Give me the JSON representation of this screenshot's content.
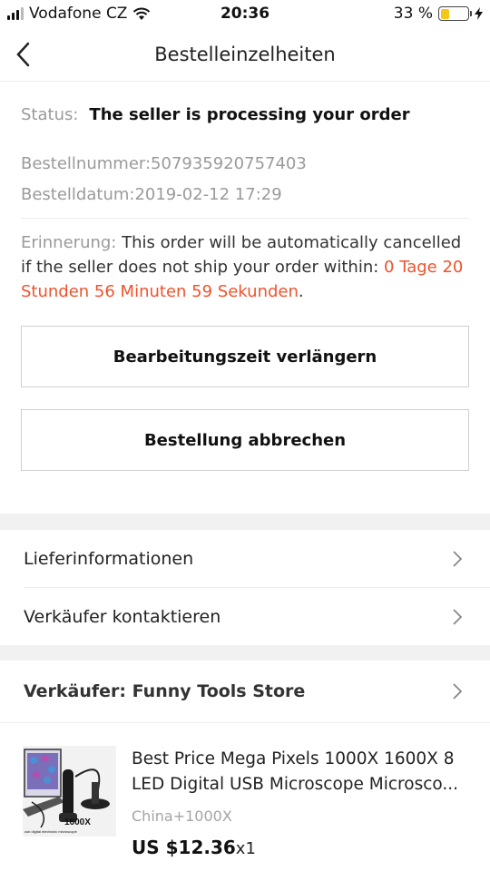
{
  "statusbar": {
    "carrier": "Vodafone CZ",
    "time": "20:36",
    "battery": "33 %",
    "battery_level": 0.33
  },
  "header": {
    "title": "Bestelleinzelheiten"
  },
  "order": {
    "status_label": "Status:",
    "status_value": "The seller is processing your order",
    "number": "Bestellnummer:507935920757403",
    "date": "Bestelldatum:2019-02-12 17:29",
    "reminder_label": "Erinnerung:",
    "reminder_text": " This order will be automatically cancelled if the seller does not ship your order within: ",
    "countdown": "0 Tage 20 Stunden 56 Minuten 59 Sekunden",
    "reminder_end": "."
  },
  "buttons": {
    "extend": "Bearbeitungszeit verlängern",
    "cancel": "Bestellung abbrechen"
  },
  "links": {
    "delivery": "Lieferinformationen",
    "contact": "Verkäufer kontaktieren"
  },
  "seller": {
    "label": "Verkäufer: Funny Tools Store"
  },
  "product": {
    "title": "Best Price Mega Pixels 1000X 1600X 8 LED Digital USB Microscope Microsco...",
    "variant": "China+1000X",
    "price": "US $12.36",
    "qty": "x1",
    "img_text": "1600X",
    "img_caption": "usb digital electronic microscope"
  },
  "colors": {
    "accent": "#f0522c",
    "muted": "#9a9a9a",
    "battery": "#f5c518"
  }
}
